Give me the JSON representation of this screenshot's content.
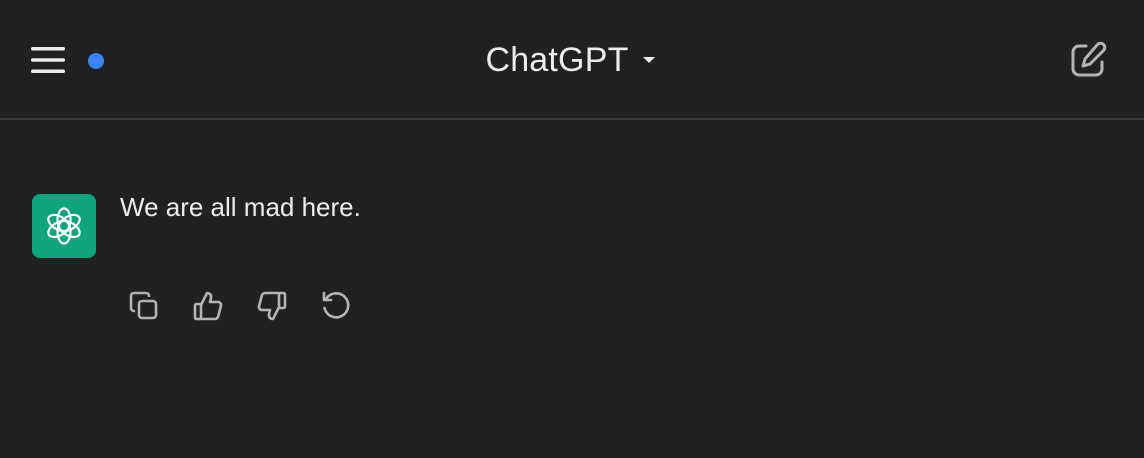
{
  "header": {
    "title": "ChatGPT",
    "status_dot_color": "#3b82f6",
    "icons": {
      "menu": "menu-icon",
      "dropdown": "chevron-down-icon",
      "new_chat": "new-chat-icon"
    }
  },
  "conversation": {
    "messages": [
      {
        "role": "assistant",
        "avatar_icon": "openai-logo-icon",
        "avatar_color": "#10a37f",
        "text": "We are all mad here."
      }
    ],
    "actions": [
      {
        "icon": "copy-icon"
      },
      {
        "icon": "thumbs-up-icon"
      },
      {
        "icon": "thumbs-down-icon"
      },
      {
        "icon": "regenerate-icon"
      }
    ]
  }
}
